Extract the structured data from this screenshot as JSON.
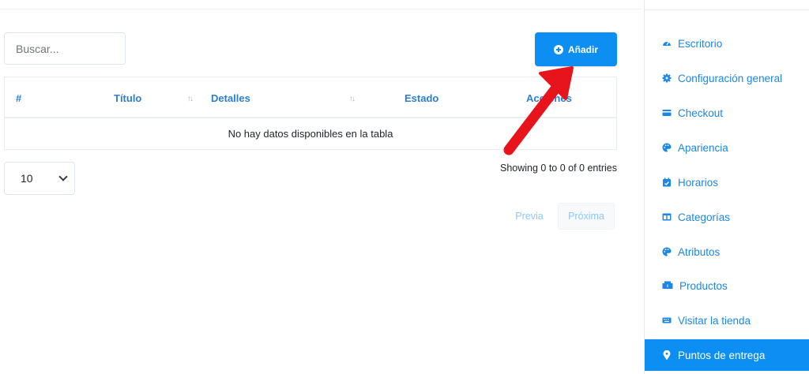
{
  "search": {
    "placeholder": "Buscar..."
  },
  "add_button": {
    "label": "Añadir"
  },
  "table": {
    "columns": [
      "#",
      "Título",
      "Detalles",
      "Estado",
      "Acciones"
    ],
    "empty_message": "No hay datos disponibles en la tabla"
  },
  "length_select": {
    "value": "10"
  },
  "info": {
    "text": "Showing 0 to 0 of 0 entries"
  },
  "pagination": {
    "previous": "Previa",
    "next": "Próxima"
  },
  "sidebar": {
    "items": [
      {
        "label": "Escritorio",
        "icon": "dashboard-icon"
      },
      {
        "label": "Configuración general",
        "icon": "gear-icon"
      },
      {
        "label": "Checkout",
        "icon": "credit-card-icon"
      },
      {
        "label": "Apariencia",
        "icon": "palette-icon"
      },
      {
        "label": "Horarios",
        "icon": "calendar-icon"
      },
      {
        "label": "Categorías",
        "icon": "columns-icon"
      },
      {
        "label": "Atributos",
        "icon": "palette-icon"
      },
      {
        "label": "Productos",
        "icon": "boxes-icon"
      },
      {
        "label": "Visitar la tienda",
        "icon": "keyboard-icon"
      },
      {
        "label": "Puntos de entrega",
        "icon": "map-marker-icon",
        "active": true
      }
    ]
  },
  "colors": {
    "accent": "#0d8ef2",
    "link": "#1b87e6",
    "annotation": "#e8141c"
  }
}
